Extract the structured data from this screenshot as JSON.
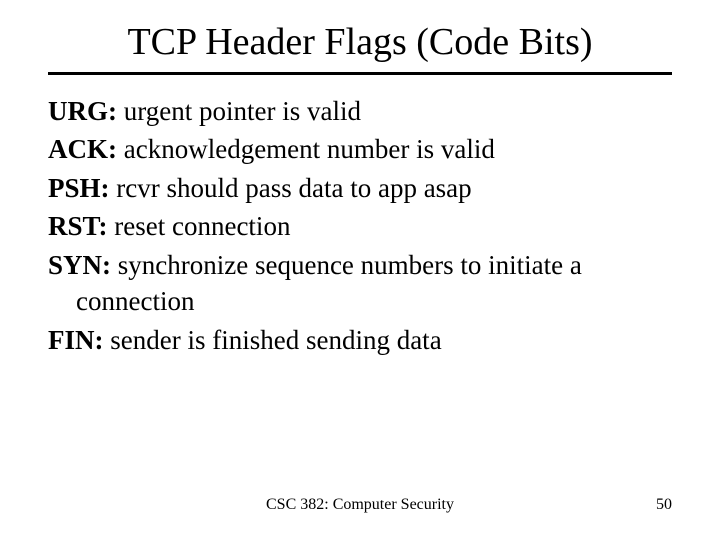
{
  "title": "TCP Header Flags (Code Bits)",
  "flags": [
    {
      "name": "URG:",
      "desc": " urgent pointer is valid"
    },
    {
      "name": "ACK:",
      "desc": " acknowledgement number is valid"
    },
    {
      "name": "PSH:",
      "desc": " rcvr should pass data to app asap"
    },
    {
      "name": "RST:",
      "desc": " reset connection"
    },
    {
      "name": "SYN:",
      "desc": " synchronize sequence numbers to initiate a connection"
    },
    {
      "name": "FIN:",
      "desc": " sender is finished sending data"
    }
  ],
  "footer": {
    "course": "CSC 382: Computer Security",
    "page": "50"
  }
}
